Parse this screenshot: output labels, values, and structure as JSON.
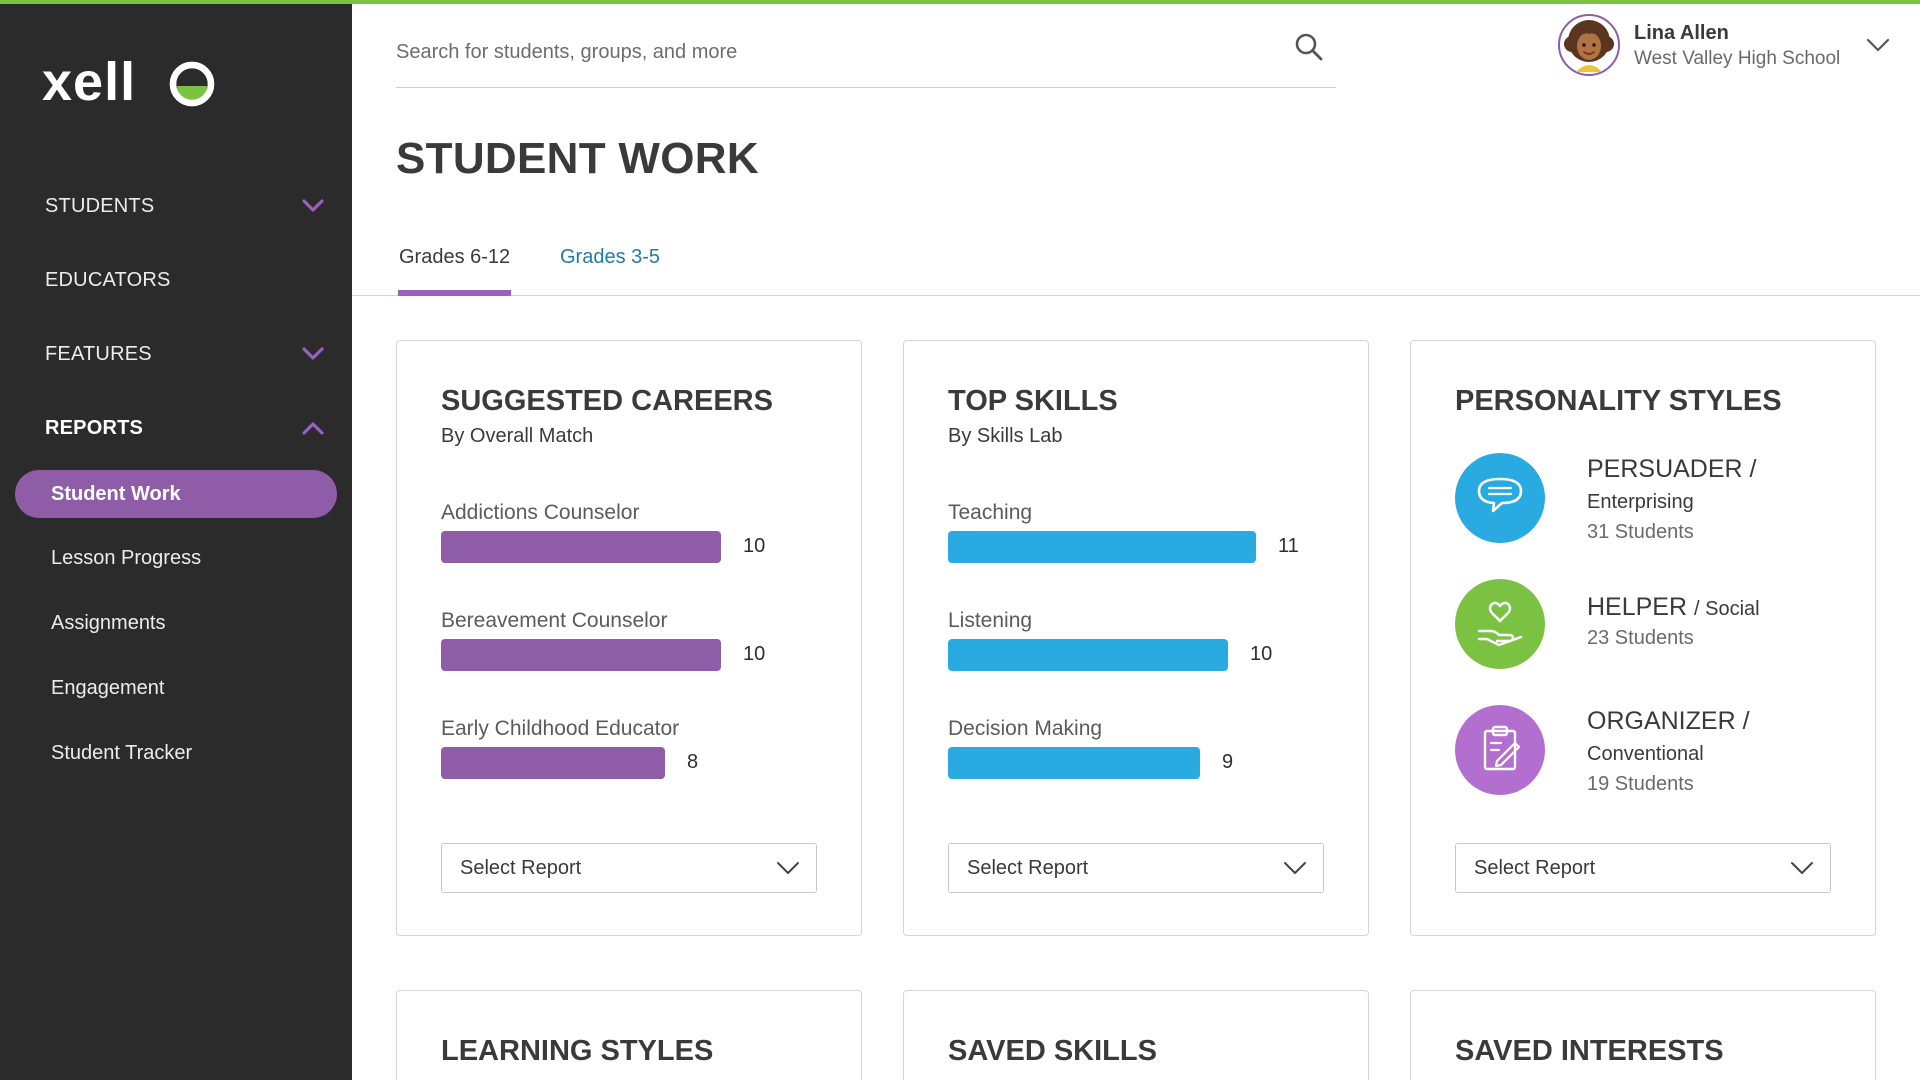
{
  "brand": {
    "logo_text": "xello",
    "accent": "#7cc242",
    "purple": "#8f5ca8",
    "blue": "#29abe2"
  },
  "sidebar": {
    "items": [
      {
        "label": "STUDENTS",
        "chevron": "down"
      },
      {
        "label": "EDUCATORS"
      },
      {
        "label": "FEATURES",
        "chevron": "down"
      },
      {
        "label": "REPORTS",
        "chevron": "up"
      }
    ],
    "sub_items": [
      {
        "label": "Student Work",
        "active": true
      },
      {
        "label": "Lesson Progress"
      },
      {
        "label": "Assignments"
      },
      {
        "label": "Engagement"
      },
      {
        "label": "Student Tracker"
      }
    ]
  },
  "header": {
    "search_placeholder": "Search for students, groups, and more",
    "user_name": "Lina Allen",
    "user_school": "West Valley High School"
  },
  "page": {
    "title": "STUDENT WORK",
    "tabs": [
      {
        "label": "Grades 6-12",
        "active": true
      },
      {
        "label": "Grades 3-5"
      }
    ]
  },
  "cards": {
    "careers": {
      "title": "SUGGESTED CAREERS",
      "subtitle": "By Overall Match",
      "select_label": "Select Report"
    },
    "skills": {
      "title": "TOP SKILLS",
      "subtitle": "By Skills Lab",
      "select_label": "Select Report"
    },
    "personality": {
      "title": "PERSONALITY STYLES",
      "select_label": "Select Report",
      "styles": [
        {
          "name": "PERSUADER",
          "category": "Enterprising",
          "count": "31 Students",
          "icon": "speech-bubble-icon",
          "color": "#29abe2"
        },
        {
          "name": "HELPER",
          "category": "Social",
          "count": "23 Students",
          "icon": "heart-hand-icon",
          "color": "#7cc242"
        },
        {
          "name": "ORGANIZER",
          "category": "Conventional",
          "count": "19 Students",
          "icon": "clipboard-icon",
          "color": "#b36fd0"
        }
      ]
    },
    "bottom": [
      {
        "title": "LEARNING STYLES"
      },
      {
        "title": "SAVED SKILLS"
      },
      {
        "title": "SAVED INTERESTS"
      }
    ]
  },
  "chart_data": [
    {
      "type": "bar",
      "title": "SUGGESTED CAREERS",
      "subtitle": "By Overall Match",
      "orientation": "horizontal",
      "categories": [
        "Addictions Counselor",
        "Bereavement Counselor",
        "Early Childhood Educator"
      ],
      "values": [
        10,
        10,
        8
      ],
      "color": "#8f5ca8"
    },
    {
      "type": "bar",
      "title": "TOP SKILLS",
      "subtitle": "By Skills Lab",
      "orientation": "horizontal",
      "categories": [
        "Teaching",
        "Listening",
        "Decision Making"
      ],
      "values": [
        11,
        10,
        9
      ],
      "color": "#29abe2"
    }
  ]
}
